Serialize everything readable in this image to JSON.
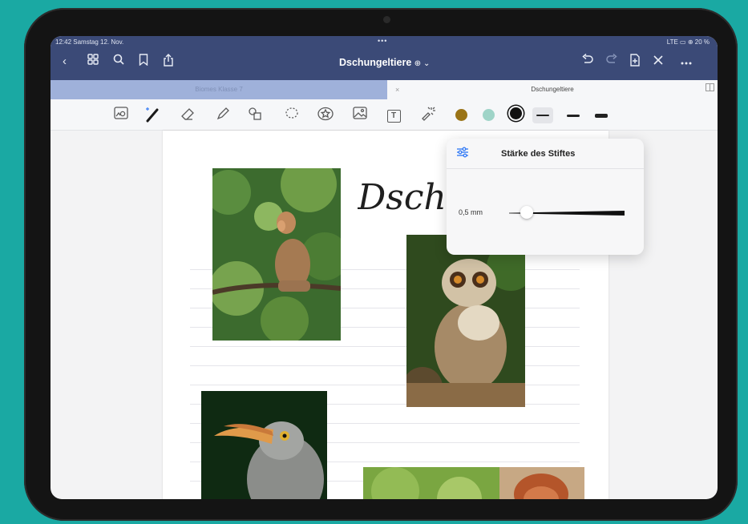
{
  "status": {
    "time_date": "12:42 Samstag 12. Nov.",
    "dots": "•••",
    "indicators": "LTE ▭ ⊕ 20 %"
  },
  "toolbar_top": {
    "title": "Dschungeltiere",
    "title_suffix": "⊕ ⌄"
  },
  "tabs": {
    "inactive_label": "Biomes Klasse 7",
    "active_label": "Dschungeltiere",
    "close": "×"
  },
  "tools": {
    "textbox_glyph": "T"
  },
  "colors": {
    "swatch_brown": "#9a7417",
    "swatch_teal": "#9fd4c8",
    "swatch_black": "#111111",
    "accent": "#3a7ff6",
    "topbar": "#3b4a77"
  },
  "heading_handwritten": "Dsch",
  "popover": {
    "title": "Stärke des Stiftes",
    "value_label": "0,5 mm",
    "slider_level": 0.12
  }
}
